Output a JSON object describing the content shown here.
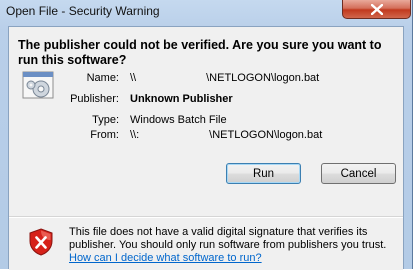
{
  "window": {
    "title": "Open File - Security Warning"
  },
  "dialog": {
    "heading": "The publisher could not be verified.  Are you sure you want to run this software?",
    "fields": {
      "name_label": "Name:",
      "name_prefix": "\\\\",
      "name_suffix": "\\NETLOGON\\logon.bat",
      "publisher_label": "Publisher:",
      "publisher_value": "Unknown Publisher",
      "type_label": "Type:",
      "type_value": "Windows Batch File",
      "from_label": "From:",
      "from_prefix": "\\\\:",
      "from_suffix": "\\NETLOGON\\logon.bat"
    },
    "buttons": {
      "run": "Run",
      "cancel": "Cancel"
    },
    "warning": {
      "text": "This file does not have a valid digital signature that verifies its publisher.  You should only run software from publishers you trust.",
      "link": "How can I decide what software to run?"
    }
  },
  "colors": {
    "link": "#0066cc",
    "close_button": "#c1391e",
    "shield_red": "#d6221a"
  }
}
